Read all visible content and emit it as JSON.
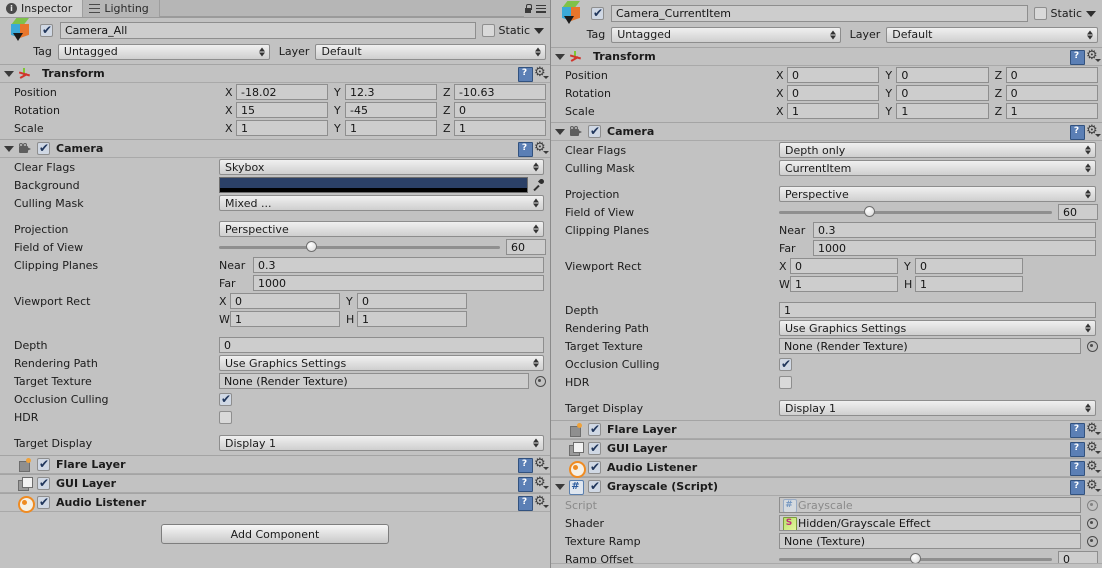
{
  "window": {
    "tabs": [
      {
        "label": "Inspector",
        "icon": "info-icon",
        "active": true
      },
      {
        "label": "Lighting",
        "icon": "lighting-icon",
        "active": false
      }
    ],
    "lock_icon": "lock-icon",
    "menu_icon": "hamburger-menu-icon"
  },
  "left": {
    "gameobject": {
      "icon": "gameobject-cube-icon",
      "enabled": true,
      "name": "Camera_All",
      "static_label": "Static",
      "static_checked": false,
      "tag_label": "Tag",
      "tag_value": "Untagged",
      "layer_label": "Layer",
      "layer_value": "Default"
    },
    "components": [
      {
        "title": "Transform",
        "icon": "transform-icon",
        "has_checkbox": false,
        "expanded": true,
        "rows": [
          {
            "type": "vector3",
            "label": "Position",
            "x": "-18.02",
            "y": "12.3",
            "z": "-10.63"
          },
          {
            "type": "vector3",
            "label": "Rotation",
            "x": "15",
            "y": "-45",
            "z": "0"
          },
          {
            "type": "vector3",
            "label": "Scale",
            "x": "1",
            "y": "1",
            "z": "1"
          }
        ]
      },
      {
        "title": "Camera",
        "icon": "camera-icon",
        "has_checkbox": true,
        "checked": true,
        "expanded": true,
        "rows": [
          {
            "type": "popup",
            "label": "Clear Flags",
            "value": "Skybox"
          },
          {
            "type": "color",
            "label": "Background",
            "color": "#2b4066"
          },
          {
            "type": "popup",
            "label": "Culling Mask",
            "value": "Mixed ..."
          },
          {
            "type": "spacer"
          },
          {
            "type": "popup",
            "label": "Projection",
            "value": "Perspective"
          },
          {
            "type": "slider",
            "label": "Field of View",
            "value": "60",
            "percent": 33
          },
          {
            "type": "clip",
            "label": "Clipping Planes",
            "near_label": "Near",
            "near": "0.3",
            "far_label": "Far",
            "far": "1000"
          },
          {
            "type": "rect",
            "label": "Viewport Rect",
            "x": "0",
            "y": "0",
            "w": "1",
            "h": "1"
          },
          {
            "type": "spacer"
          },
          {
            "type": "text",
            "label": "Depth",
            "value": "0"
          },
          {
            "type": "popup",
            "label": "Rendering Path",
            "value": "Use Graphics Settings"
          },
          {
            "type": "object",
            "label": "Target Texture",
            "value": "None (Render Texture)"
          },
          {
            "type": "checkbox",
            "label": "Occlusion Culling",
            "checked": true
          },
          {
            "type": "checkbox",
            "label": "HDR",
            "checked": false
          },
          {
            "type": "spacer"
          },
          {
            "type": "popup",
            "label": "Target Display",
            "value": "Display 1"
          }
        ]
      },
      {
        "title": "Flare Layer",
        "icon": "flare-layer-icon",
        "has_checkbox": true,
        "checked": true,
        "expanded": false,
        "rows": []
      },
      {
        "title": "GUI Layer",
        "icon": "gui-layer-icon",
        "has_checkbox": true,
        "checked": true,
        "expanded": false,
        "rows": []
      },
      {
        "title": "Audio Listener",
        "icon": "audio-listener-icon",
        "has_checkbox": true,
        "checked": true,
        "expanded": false,
        "rows": []
      }
    ],
    "add_component_label": "Add Component"
  },
  "right": {
    "gameobject": {
      "icon": "gameobject-cube-icon",
      "enabled": true,
      "name": "Camera_CurrentItem",
      "static_label": "Static",
      "static_checked": false,
      "tag_label": "Tag",
      "tag_value": "Untagged",
      "layer_label": "Layer",
      "layer_value": "Default"
    },
    "components": [
      {
        "title": "Transform",
        "icon": "transform-icon",
        "has_checkbox": false,
        "expanded": true,
        "rows": [
          {
            "type": "vector3",
            "label": "Position",
            "x": "0",
            "y": "0",
            "z": "0"
          },
          {
            "type": "vector3",
            "label": "Rotation",
            "x": "0",
            "y": "0",
            "z": "0"
          },
          {
            "type": "vector3",
            "label": "Scale",
            "x": "1",
            "y": "1",
            "z": "1"
          }
        ]
      },
      {
        "title": "Camera",
        "icon": "camera-icon",
        "has_checkbox": true,
        "checked": true,
        "expanded": true,
        "rows": [
          {
            "type": "popup",
            "label": "Clear Flags",
            "value": "Depth only"
          },
          {
            "type": "popup",
            "label": "Culling Mask",
            "value": "CurrentItem"
          },
          {
            "type": "spacer"
          },
          {
            "type": "popup",
            "label": "Projection",
            "value": "Perspective"
          },
          {
            "type": "slider",
            "label": "Field of View",
            "value": "60",
            "percent": 33
          },
          {
            "type": "clip",
            "label": "Clipping Planes",
            "near_label": "Near",
            "near": "0.3",
            "far_label": "Far",
            "far": "1000"
          },
          {
            "type": "rect",
            "label": "Viewport Rect",
            "x": "0",
            "y": "0",
            "w": "1",
            "h": "1"
          },
          {
            "type": "spacer"
          },
          {
            "type": "text",
            "label": "Depth",
            "value": "1"
          },
          {
            "type": "popup",
            "label": "Rendering Path",
            "value": "Use Graphics Settings"
          },
          {
            "type": "object",
            "label": "Target Texture",
            "value": "None (Render Texture)"
          },
          {
            "type": "checkbox",
            "label": "Occlusion Culling",
            "checked": true
          },
          {
            "type": "checkbox",
            "label": "HDR",
            "checked": false
          },
          {
            "type": "spacer"
          },
          {
            "type": "popup",
            "label": "Target Display",
            "value": "Display 1"
          }
        ]
      },
      {
        "title": "Flare Layer",
        "icon": "flare-layer-icon",
        "has_checkbox": true,
        "checked": true,
        "expanded": false,
        "rows": []
      },
      {
        "title": "GUI Layer",
        "icon": "gui-layer-icon",
        "has_checkbox": true,
        "checked": true,
        "expanded": false,
        "rows": []
      },
      {
        "title": "Audio Listener",
        "icon": "audio-listener-icon",
        "has_checkbox": true,
        "checked": true,
        "expanded": false,
        "rows": []
      },
      {
        "title": "Grayscale (Script)",
        "icon": "csharp-script-icon",
        "has_checkbox": true,
        "checked": true,
        "expanded": true,
        "rows": [
          {
            "type": "object",
            "label": "Script",
            "value": "Grayscale",
            "disabled": true,
            "value_icon": "csharp-script-mini-icon"
          },
          {
            "type": "object",
            "label": "Shader",
            "value": "Hidden/Grayscale Effect",
            "value_icon": "shader-mini-icon"
          },
          {
            "type": "object",
            "label": "Texture Ramp",
            "value": "None (Texture)"
          },
          {
            "type": "slider",
            "label": "Ramp Offset",
            "value": "0",
            "percent": 50
          }
        ]
      }
    ]
  }
}
